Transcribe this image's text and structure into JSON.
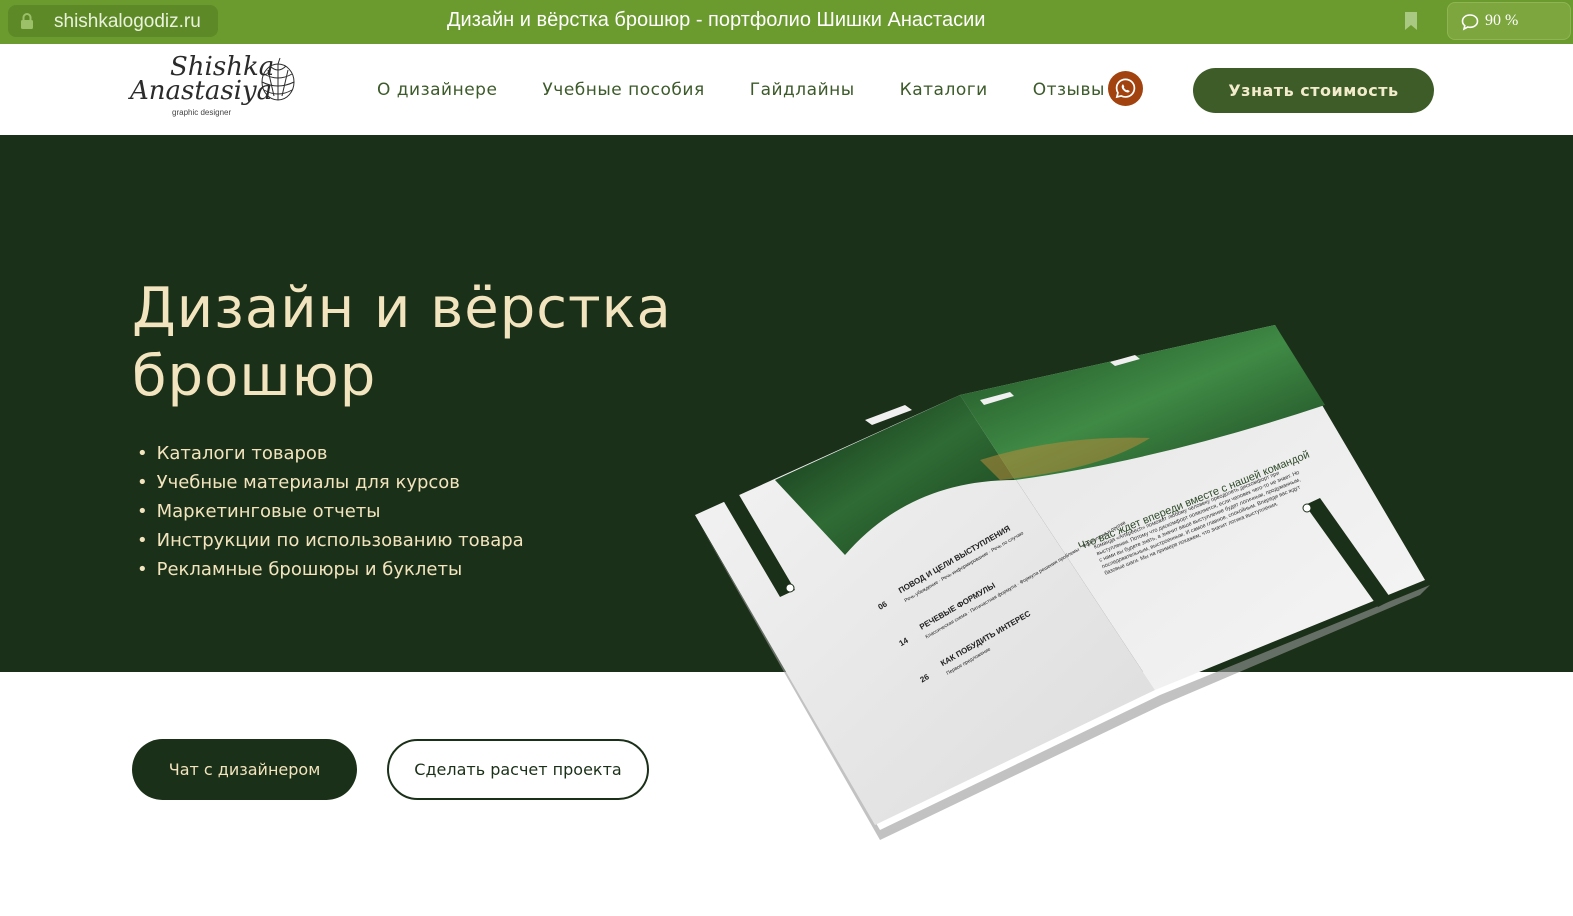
{
  "browser": {
    "url": "shishkalogodiz.ru",
    "tab_title": "Дизайн и вёрстка брошюр - портфолио Шишки Анастасии",
    "zoom": "90 %"
  },
  "logo": {
    "line1": "Shishka",
    "line2": "Anastasiya",
    "tagline": "graphic designer"
  },
  "nav": {
    "items": [
      {
        "label": "О дизайнере"
      },
      {
        "label": "Учебные пособия"
      },
      {
        "label": "Гайдлайны"
      },
      {
        "label": "Каталоги"
      },
      {
        "label": "Отзывы"
      }
    ],
    "cta_label": "Узнать стоимость"
  },
  "hero": {
    "title": "Дизайн и вёрстка брошюр",
    "bullets": [
      "Каталоги товаров",
      "Учебные материалы для курсов",
      "Маркетинговые отчеты",
      "Инструкции по использованию товара",
      "Рекламные брошюры и буклеты"
    ]
  },
  "actions": {
    "chat_label": "Чат с дизайнером",
    "calc_label": "Сделать расчет проекта"
  },
  "brochure": {
    "toc": [
      {
        "page": "06",
        "heading": "ПОВОД И ЦЕЛИ ВЫСТУПЛЕНИЯ",
        "items": "Речь-убеждение · Речь-информирование · Речь по случаю"
      },
      {
        "page": "14",
        "heading": "РЕЧЕВЫЕ ФОРМУЛЫ",
        "items": "Классическая схема · Пятичастная формула · Формула решения проблемы · Формула за и против"
      },
      {
        "page": "26",
        "heading": "КАК ПОБУДИТЬ ИНТЕРЕС",
        "items": "Первое предложение"
      }
    ],
    "right_heading": "Что вас ждет впереди вместе с нашей командой",
    "right_body": "Команда «Artspeech» поможет любому человеку преодолеть дискомфорт при выступлении. Потому что дискомфорт появляется, если человек чего-то не знает. Но с нами вы будете знать, а значит ваше выступление будет логичным, продуманным, последовательным, выстроенным. И самое главное, спокойным. Впереди вас ждут базовые шаги. Мы на примере покажем, что значит логика выступления."
  },
  "colors": {
    "browser_green": "#6b9a2e",
    "hero_bg": "#1b3018",
    "cream": "#f2e4be",
    "nav_green": "#3c5a2a",
    "whatsapp": "#a2420e"
  }
}
